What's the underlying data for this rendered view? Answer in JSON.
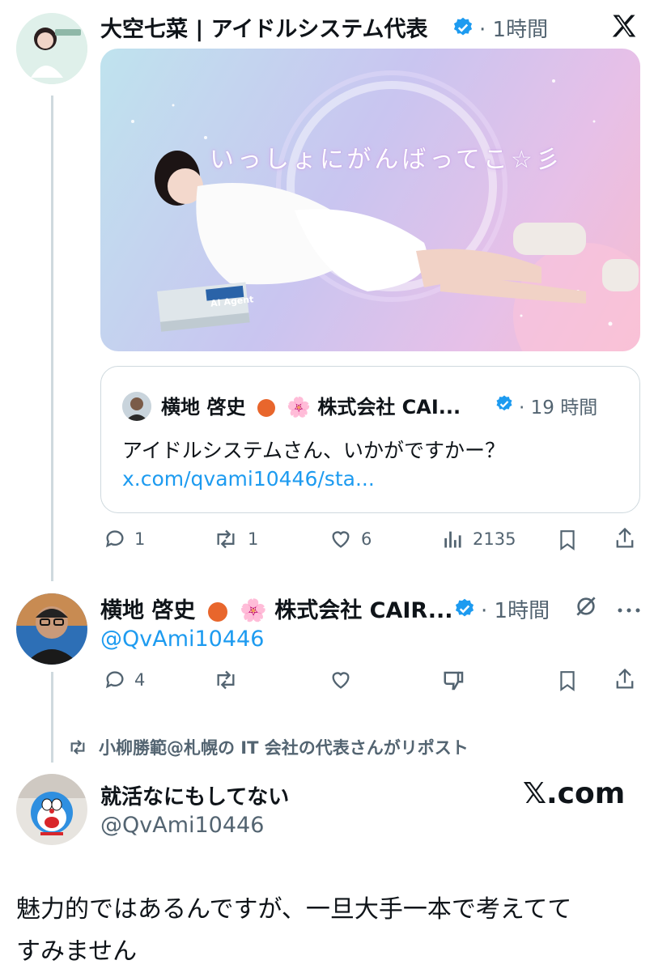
{
  "tweet1": {
    "author": "大空七菜 | アイドルシステム代表",
    "time": "· 1時間",
    "banner_text": "いっしょにがんばってこ☆彡",
    "book_label": "AI Agent",
    "quote": {
      "author": "横地 啓史",
      "emoji": "🌸",
      "org": "株式会社 CAI...",
      "time": "· 19 時間",
      "text": "アイドルシステムさん、いかがですかー？",
      "link": "x.com/qvami10446/sta..."
    },
    "actions": {
      "replies": "1",
      "reposts": "1",
      "likes": "6",
      "views": "2135"
    }
  },
  "tweet2": {
    "author": "横地 啓史",
    "emoji": "🌸",
    "org": "株式会社 CAIR...",
    "time": "· 1時間",
    "handle": "@QvAmi10446",
    "actions": {
      "replies": "4"
    }
  },
  "retweet_notice": "小柳勝範@札幌の IT 会社の代表さんがリポスト",
  "tweet3": {
    "author": "就活なにもしてない",
    "handle": "@QvAmi10446",
    "watermark": "𝕏.com",
    "text_line1": "魅力的ではあるんですが、一旦大手一本で考えてて",
    "text_line2": "すみません"
  },
  "colors": {
    "accent": "#1d9bf0",
    "muted": "#536471",
    "border": "#cfd9de"
  },
  "icons": [
    "x-logo-icon",
    "verified-icon",
    "reply-icon",
    "repost-icon",
    "like-icon",
    "views-icon",
    "bookmark-icon",
    "share-icon",
    "more-icon",
    "hidden-icon",
    "dislike-icon"
  ]
}
